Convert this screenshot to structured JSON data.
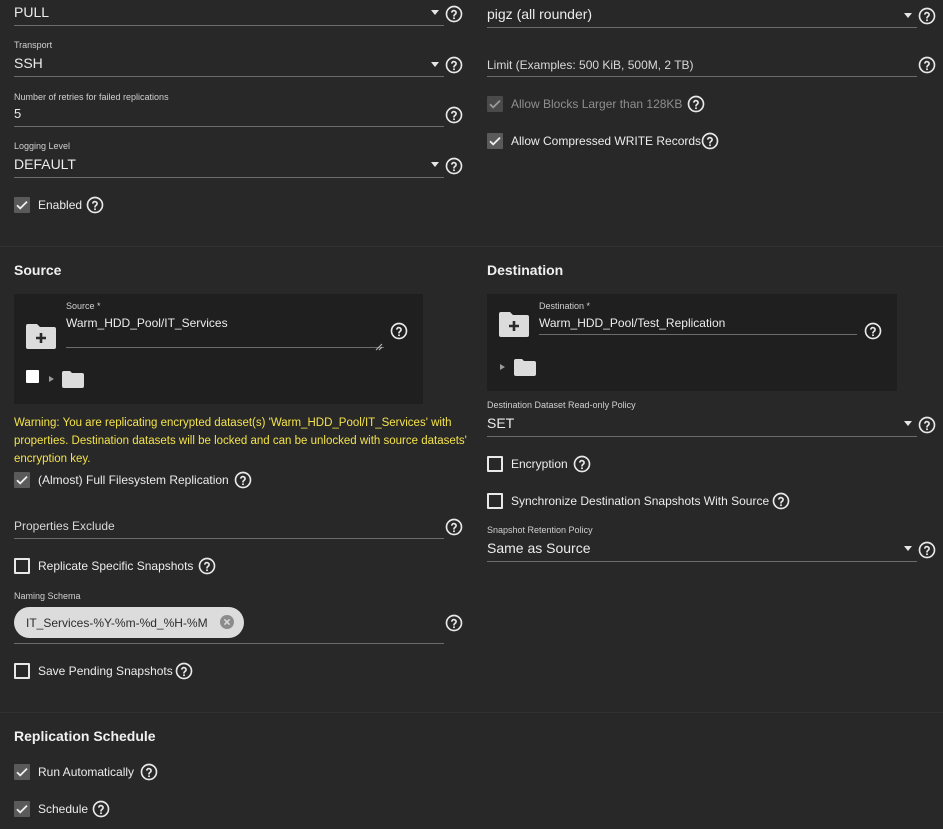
{
  "general": {
    "direction_value": "PULL",
    "transport_label": "Transport",
    "transport_value": "SSH",
    "retries_label": "Number of retries for failed replications",
    "retries_value": "5",
    "logging_label": "Logging Level",
    "logging_value": "DEFAULT",
    "enabled_label": "Enabled"
  },
  "compression": {
    "compression_value": "pigz (all rounder)",
    "limit_placeholder": "Limit (Examples: 500 KiB, 500M, 2 TB)",
    "allow_large_blocks_label": "Allow Blocks Larger than 128KB",
    "allow_compressed_label": "Allow Compressed WRITE Records"
  },
  "source": {
    "title": "Source",
    "field_label": "Source *",
    "field_value": "Warm_HDD_Pool/IT_Services",
    "warning": "Warning: You are replicating encrypted dataset(s) 'Warm_HDD_Pool/IT_Services' with properties. Destination datasets will be locked and can be unlocked with source datasets' encryption key.",
    "full_fs_label": "(Almost) Full Filesystem Replication",
    "properties_exclude_placeholder": "Properties Exclude",
    "replicate_specific_label": "Replicate Specific Snapshots",
    "naming_schema_label": "Naming Schema",
    "naming_schema_chip": "IT_Services-%Y-%m-%d_%H-%M",
    "save_pending_label": "Save Pending Snapshots"
  },
  "destination": {
    "title": "Destination",
    "field_label": "Destination *",
    "field_value": "Warm_HDD_Pool/Test_Replication",
    "readonly_label": "Destination Dataset Read-only Policy",
    "readonly_value": "SET",
    "encryption_label": "Encryption",
    "sync_label": "Synchronize Destination Snapshots With Source",
    "retention_label": "Snapshot Retention Policy",
    "retention_value": "Same as Source"
  },
  "schedule": {
    "title": "Replication Schedule",
    "run_auto_label": "Run Automatically",
    "schedule_label": "Schedule"
  },
  "colors": {
    "background": "#282828",
    "warning": "#f3e24b",
    "explorer_bg": "#1f1f1f"
  }
}
